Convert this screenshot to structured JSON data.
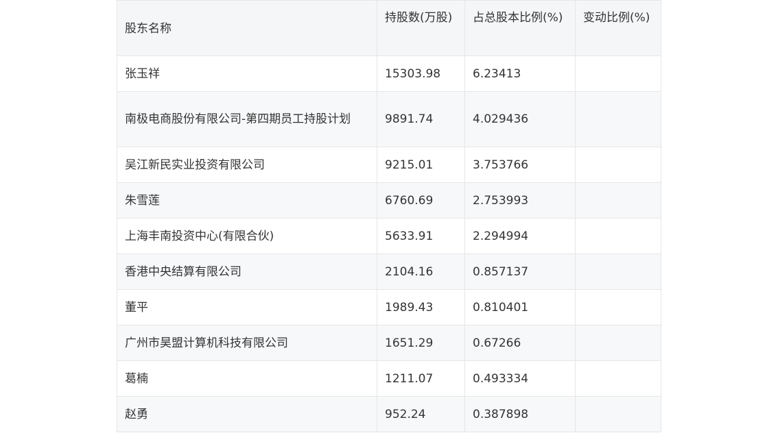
{
  "table": {
    "headers": [
      "股东名称",
      "持股数(万股)",
      "占总股本比例(%)",
      "变动比例(%)"
    ],
    "rows": [
      {
        "name": "张玉祥",
        "shares": "15303.98",
        "ratio": "6.23413",
        "change": ""
      },
      {
        "name": "南极电商股份有限公司-第四期员工持股计划",
        "shares": "9891.74",
        "ratio": "4.029436",
        "change": ""
      },
      {
        "name": "吴江新民实业投资有限公司",
        "shares": "9215.01",
        "ratio": "3.753766",
        "change": ""
      },
      {
        "name": "朱雪莲",
        "shares": "6760.69",
        "ratio": "2.753993",
        "change": ""
      },
      {
        "name": "上海丰南投资中心(有限合伙)",
        "shares": "5633.91",
        "ratio": "2.294994",
        "change": ""
      },
      {
        "name": "香港中央结算有限公司",
        "shares": "2104.16",
        "ratio": "0.857137",
        "change": ""
      },
      {
        "name": "董平",
        "shares": "1989.43",
        "ratio": "0.810401",
        "change": ""
      },
      {
        "name": "广州市昊盟计算机科技有限公司",
        "shares": "1651.29",
        "ratio": "0.67266",
        "change": ""
      },
      {
        "name": "葛楠",
        "shares": "1211.07",
        "ratio": "0.493334",
        "change": ""
      },
      {
        "name": "赵勇",
        "shares": "952.24",
        "ratio": "0.387898",
        "change": ""
      }
    ]
  }
}
